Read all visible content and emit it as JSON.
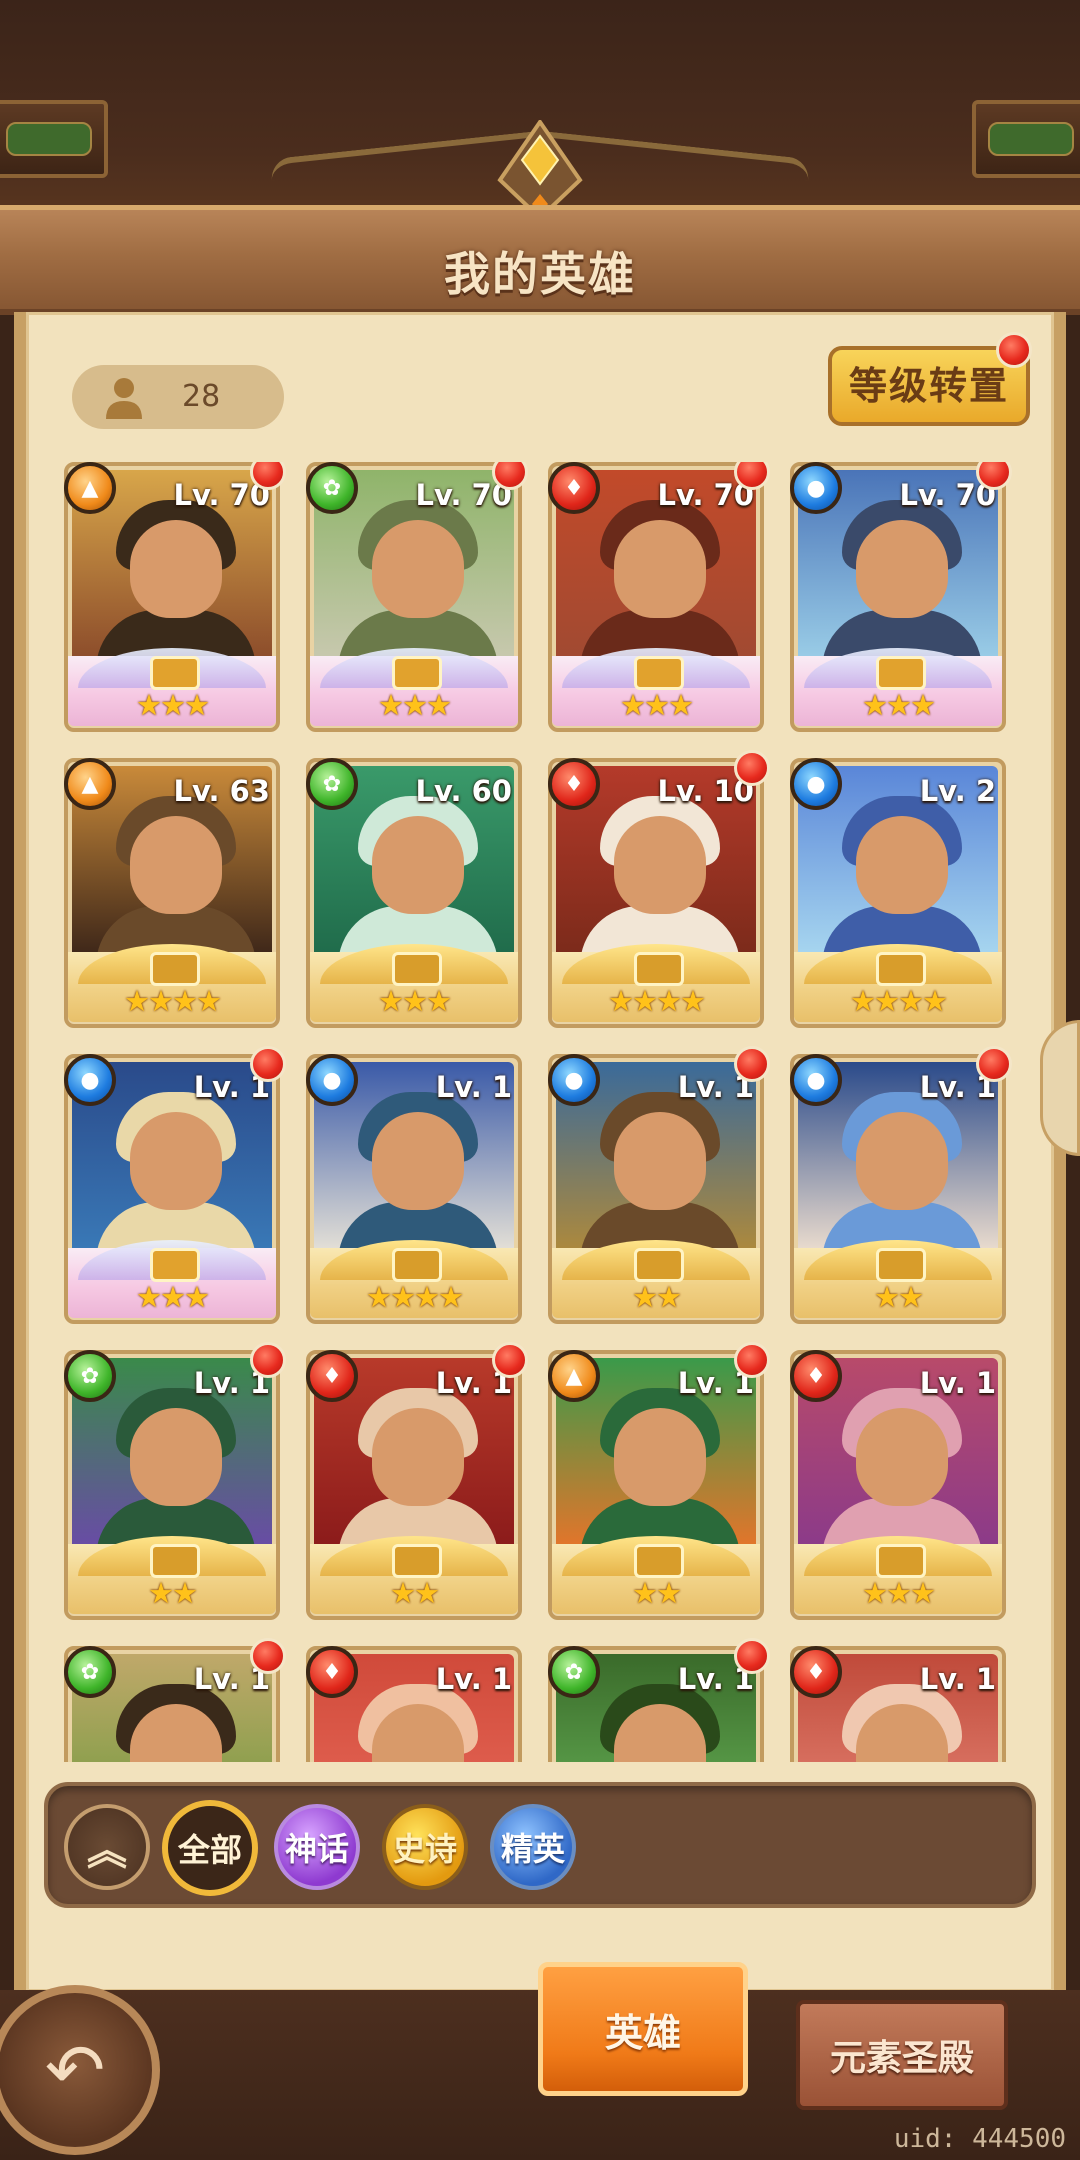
{
  "header": {
    "title": "我的英雄"
  },
  "hero_count": "28",
  "reset_button": {
    "label": "等级转置"
  },
  "heroes": [
    {
      "level": "Lv. 70",
      "stars": "★★★",
      "element": "light",
      "rarity": "mythic",
      "notify": true,
      "palette": [
        "#d8a64a",
        "#8a4a2a",
        "#3a2a1a"
      ]
    },
    {
      "level": "Lv. 70",
      "stars": "★★★",
      "element": "nature",
      "rarity": "mythic",
      "notify": true,
      "palette": [
        "#8fb46a",
        "#c9c9b0",
        "#6b7a4a"
      ]
    },
    {
      "level": "Lv. 70",
      "stars": "★★★",
      "element": "fire",
      "rarity": "mythic",
      "notify": true,
      "palette": [
        "#c24a2a",
        "#a04a32",
        "#6a2a1a"
      ]
    },
    {
      "level": "Lv. 70",
      "stars": "★★★",
      "element": "water",
      "rarity": "mythic",
      "notify": true,
      "palette": [
        "#4a74b8",
        "#9ccfe8",
        "#3a4a6a"
      ]
    },
    {
      "level": "Lv. 63",
      "stars": "★★★★",
      "element": "light",
      "rarity": "epic",
      "notify": false,
      "palette": [
        "#c98a3a",
        "#3a2418",
        "#6a4a2a"
      ]
    },
    {
      "level": "Lv. 60",
      "stars": "★★★",
      "element": "nature",
      "rarity": "epic",
      "notify": false,
      "palette": [
        "#3a9a6a",
        "#1f6a4a",
        "#cfe9d8"
      ]
    },
    {
      "level": "Lv. 10",
      "stars": "★★★★",
      "element": "fire",
      "rarity": "elite",
      "notify": true,
      "palette": [
        "#b43a2a",
        "#7a2a1a",
        "#f2e6d6"
      ]
    },
    {
      "level": "Lv. 2",
      "stars": "★★★★",
      "element": "water",
      "rarity": "elite",
      "notify": false,
      "palette": [
        "#5a86d8",
        "#a9d8f0",
        "#3f5ea8"
      ]
    },
    {
      "level": "Lv. 1",
      "stars": "★★★",
      "element": "water",
      "rarity": "mythic",
      "notify": true,
      "palette": [
        "#2a4a8a",
        "#3a7ab8",
        "#e9d8a8"
      ]
    },
    {
      "level": "Lv. 1",
      "stars": "★★★★",
      "element": "water",
      "rarity": "epic",
      "notify": false,
      "palette": [
        "#3a5aa8",
        "#e9e4d8",
        "#2f5a7a"
      ]
    },
    {
      "level": "Lv. 1",
      "stars": "★★",
      "element": "water",
      "rarity": "epic",
      "notify": true,
      "palette": [
        "#3a6a9a",
        "#b08a3a",
        "#6a4a2a"
      ]
    },
    {
      "level": "Lv. 1",
      "stars": "★★",
      "element": "water",
      "rarity": "epic",
      "notify": true,
      "palette": [
        "#2a4a8a",
        "#f0e0d0",
        "#6a9ad8"
      ]
    },
    {
      "level": "Lv. 1",
      "stars": "★★",
      "element": "nature",
      "rarity": "epic",
      "notify": true,
      "palette": [
        "#3a8a4a",
        "#6a4aa8",
        "#2a5a3a"
      ]
    },
    {
      "level": "Lv. 1",
      "stars": "★★",
      "element": "fire",
      "rarity": "epic",
      "notify": true,
      "palette": [
        "#b83a2a",
        "#8a1a1a",
        "#e8c8a8"
      ]
    },
    {
      "level": "Lv. 1",
      "stars": "★★",
      "element": "light",
      "rarity": "epic",
      "notify": true,
      "palette": [
        "#3a9a4a",
        "#e8742a",
        "#2a6a3a"
      ]
    },
    {
      "level": "Lv. 1",
      "stars": "★★★",
      "element": "fire",
      "rarity": "epic",
      "notify": false,
      "palette": [
        "#b84a6a",
        "#8a3a8a",
        "#e0a0b0"
      ]
    },
    {
      "level": "Lv. 1",
      "stars": "",
      "element": "nature",
      "rarity": "epic",
      "notify": true,
      "palette": [
        "#c0a86a",
        "#6a9a3a",
        "#3a2a1a"
      ]
    },
    {
      "level": "Lv. 1",
      "stars": "",
      "element": "fire",
      "rarity": "epic",
      "notify": false,
      "palette": [
        "#d04a3a",
        "#e86a5a",
        "#f0c0a0"
      ]
    },
    {
      "level": "Lv. 1",
      "stars": "",
      "element": "nature",
      "rarity": "epic",
      "notify": true,
      "palette": [
        "#3a6a2a",
        "#6ab85a",
        "#2a4a1a"
      ]
    },
    {
      "level": "Lv. 1",
      "stars": "",
      "element": "fire",
      "rarity": "epic",
      "notify": false,
      "palette": [
        "#c04a3a",
        "#e88a7a",
        "#f0c8b0"
      ]
    }
  ],
  "filters": {
    "collapse_icon": "double-chevron-up-icon",
    "all": "全部",
    "mythic": "神话",
    "epic": "史诗",
    "elite": "精英"
  },
  "nav": {
    "back_icon": "back-arrow-icon",
    "heroes_tab": "英雄",
    "temple_tab": "元素圣殿"
  },
  "uid": "uid: 444500"
}
